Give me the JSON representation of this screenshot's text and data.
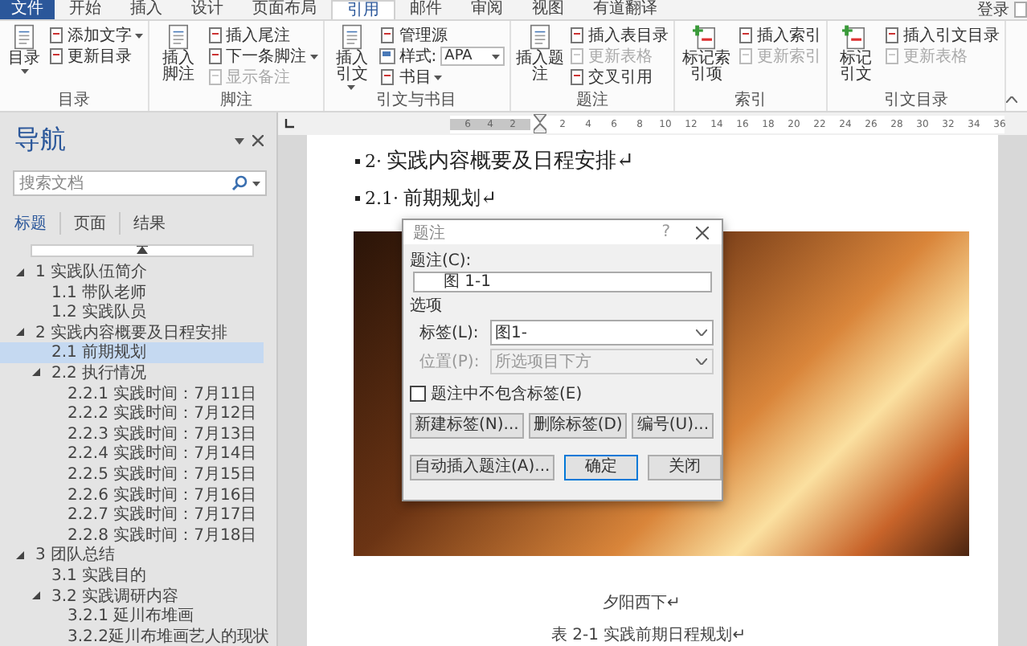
{
  "tabs": [
    {
      "label": "文件",
      "kind": "file",
      "selected": false
    },
    {
      "label": "开始",
      "kind": "tab",
      "selected": false
    },
    {
      "label": "插入",
      "kind": "tab",
      "selected": false
    },
    {
      "label": "设计",
      "kind": "tab",
      "selected": false
    },
    {
      "label": "页面布局",
      "kind": "tab",
      "selected": false
    },
    {
      "label": "引用",
      "kind": "tab",
      "selected": true
    },
    {
      "label": "邮件",
      "kind": "tab",
      "selected": false
    },
    {
      "label": "审阅",
      "kind": "tab",
      "selected": false
    },
    {
      "label": "视图",
      "kind": "tab",
      "selected": false
    },
    {
      "label": "有道翻译",
      "kind": "tab",
      "selected": false
    }
  ],
  "sign_in": "登录",
  "ribbon": {
    "groups": [
      {
        "label": "目录",
        "large": [
          {
            "label": "目录",
            "dropdown": true
          }
        ],
        "small": [
          {
            "label": "添加文字",
            "kind": "button",
            "dropdown": true,
            "disabled": false
          },
          {
            "label": "更新目录",
            "kind": "button",
            "dropdown": false,
            "disabled": false
          }
        ]
      },
      {
        "label": "脚注",
        "large": [
          {
            "label": "插入脚注",
            "dropdown": false
          }
        ],
        "small": [
          {
            "label": "插入尾注",
            "kind": "button",
            "dropdown": false,
            "disabled": false
          },
          {
            "label": "下一条脚注",
            "kind": "button",
            "dropdown": true,
            "disabled": false
          },
          {
            "label": "显示备注",
            "kind": "button",
            "dropdown": false,
            "disabled": true
          }
        ]
      },
      {
        "label": "引文与书目",
        "large": [
          {
            "label": "插入引文",
            "dropdown": true
          }
        ],
        "small": [
          {
            "label": "管理源",
            "kind": "button",
            "dropdown": false,
            "disabled": false
          },
          {
            "label": "样式:",
            "kind": "combo",
            "value": "APA"
          },
          {
            "label": "书目",
            "kind": "button",
            "dropdown": true,
            "disabled": false
          }
        ]
      },
      {
        "label": "题注",
        "large": [
          {
            "label": "插入题注",
            "dropdown": false
          }
        ],
        "small": [
          {
            "label": "插入表目录",
            "kind": "button",
            "dropdown": false,
            "disabled": false
          },
          {
            "label": "更新表格",
            "kind": "button",
            "dropdown": false,
            "disabled": true
          },
          {
            "label": "交叉引用",
            "kind": "button",
            "dropdown": false,
            "disabled": false
          }
        ]
      },
      {
        "label": "索引",
        "large": [
          {
            "label": "标记索引项",
            "dropdown": false
          }
        ],
        "small": [
          {
            "label": "插入索引",
            "kind": "button",
            "dropdown": false,
            "disabled": false
          },
          {
            "label": "更新索引",
            "kind": "button",
            "dropdown": false,
            "disabled": true
          }
        ]
      },
      {
        "label": "引文目录",
        "large": [
          {
            "label": "标记引文",
            "dropdown": false
          }
        ],
        "small": [
          {
            "label": "插入引文目录",
            "kind": "button",
            "dropdown": false,
            "disabled": false
          },
          {
            "label": "更新表格",
            "kind": "button",
            "dropdown": false,
            "disabled": true
          }
        ]
      }
    ]
  },
  "navigation": {
    "title": "导航",
    "search": {
      "placeholder": "搜索文档"
    },
    "tabs": [
      {
        "label": "标题",
        "selected": true
      },
      {
        "label": "页面",
        "selected": false
      },
      {
        "label": "结果",
        "selected": false
      }
    ],
    "tree": [
      {
        "label": "1 实践队伍简介",
        "expanded": true,
        "selected": false,
        "children": [
          {
            "label": "1.1 带队老师",
            "selected": false
          },
          {
            "label": "1.2 实践队员",
            "selected": false
          }
        ]
      },
      {
        "label": "2 实践内容概要及日程安排",
        "expanded": true,
        "selected": false,
        "children": [
          {
            "label": "2.1 前期规划",
            "selected": true
          },
          {
            "label": "2.2 执行情况",
            "expanded": true,
            "selected": false,
            "children": [
              {
                "label": "2.2.1 实践时间：7月11日",
                "selected": false
              },
              {
                "label": "2.2.2 实践时间：7月12日",
                "selected": false
              },
              {
                "label": "2.2.3 实践时间：7月13日",
                "selected": false
              },
              {
                "label": "2.2.4 实践时间：7月14日",
                "selected": false
              },
              {
                "label": "2.2.5 实践时间：7月15日",
                "selected": false
              },
              {
                "label": "2.2.6 实践时间：7月16日",
                "selected": false
              },
              {
                "label": "2.2.7 实践时间：7月17日",
                "selected": false
              },
              {
                "label": "2.2.8 实践时间：7月18日",
                "selected": false
              }
            ]
          }
        ]
      },
      {
        "label": "3 团队总结",
        "expanded": true,
        "selected": false,
        "children": [
          {
            "label": "3.1 实践目的",
            "selected": false
          },
          {
            "label": "3.2 实践调研内容",
            "expanded": true,
            "selected": false,
            "children": [
              {
                "label": "3.2.1 延川布堆画",
                "selected": false
              },
              {
                "label": "3.2.2延川布堆画艺人的现状",
                "selected": false
              }
            ]
          }
        ]
      }
    ]
  },
  "ruler": {
    "left_ticks": [
      "6",
      "4",
      "2"
    ],
    "right_ticks": [
      "2",
      "4",
      "6",
      "8",
      "10",
      "12",
      "14",
      "16",
      "18",
      "20",
      "22",
      "24",
      "26",
      "28",
      "30",
      "32",
      "34",
      "36"
    ]
  },
  "document": {
    "headings": [
      {
        "number": "2·",
        "text": "实践内容概要及日程安排↵",
        "kind": "h1"
      },
      {
        "number": "2.1·",
        "text": "前期规划↵",
        "kind": "h2"
      }
    ],
    "image_caption": "夕阳西下↵",
    "table_caption": "表 2-1  实践前期日程规划↵"
  },
  "dialog": {
    "title": "题注",
    "help": "?",
    "caption_label": "题注(C):",
    "caption_value": "图 1-1",
    "options_label": "选项",
    "fields": [
      {
        "label": "标签(L):",
        "value": "图1-",
        "disabled": false
      },
      {
        "label": "位置(P):",
        "value": "所选项目下方",
        "disabled": true
      }
    ],
    "exclude_label": {
      "label": "题注中不包含标签(E)",
      "checked": false
    },
    "buttons": [
      {
        "label": "新建标签(N)...",
        "default": false
      },
      {
        "label": "删除标签(D)",
        "default": false
      },
      {
        "label": "编号(U)...",
        "default": false
      },
      {
        "label": "自动插入题注(A)...",
        "default": false
      },
      {
        "label": "确定",
        "default": true
      },
      {
        "label": "关闭",
        "default": false
      }
    ]
  }
}
